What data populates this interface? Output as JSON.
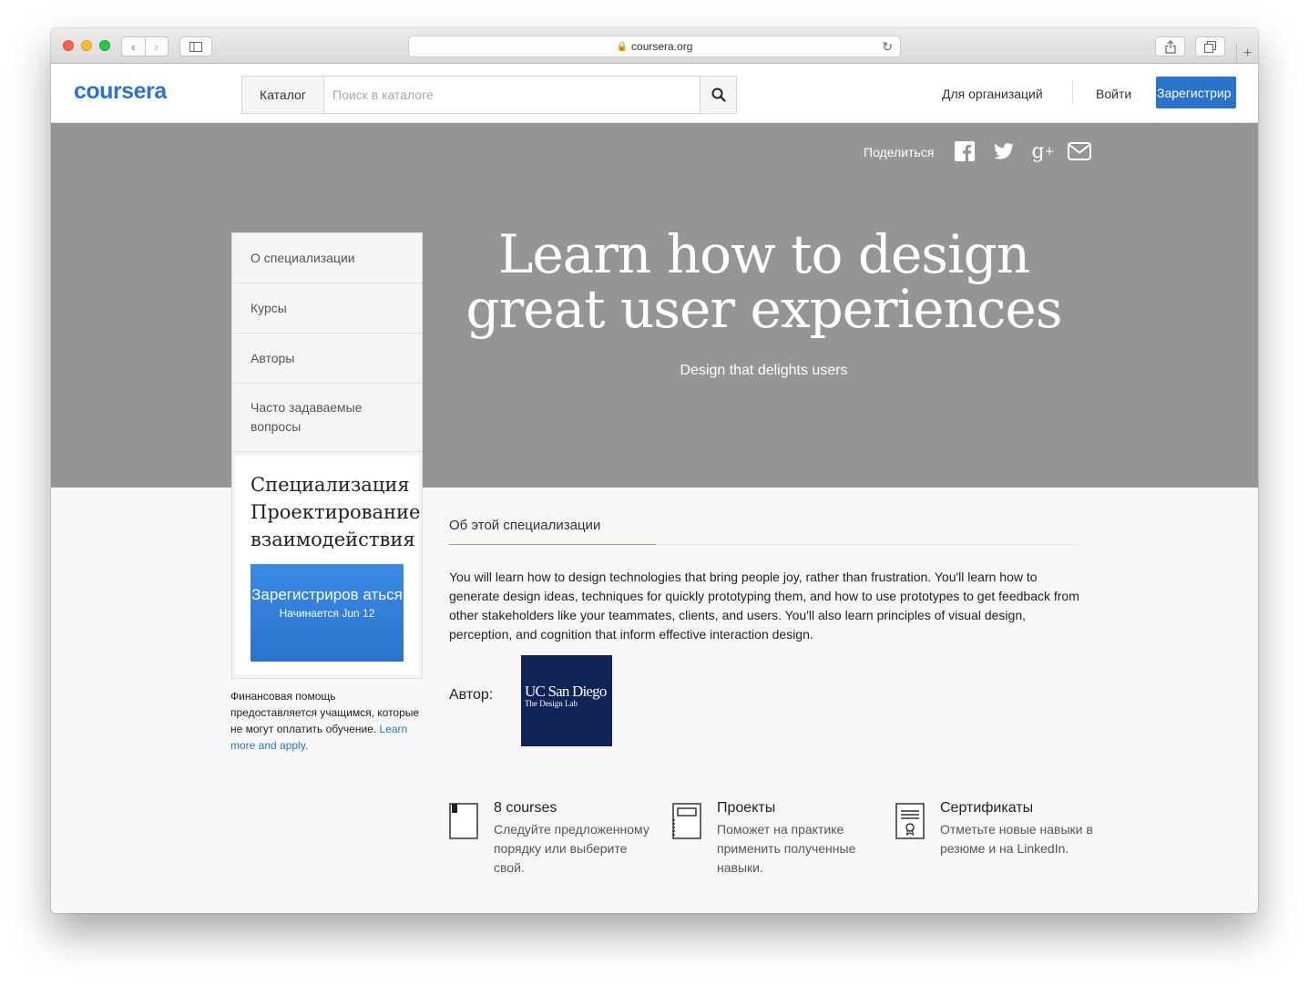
{
  "browser": {
    "url": "coursera.org"
  },
  "header": {
    "logo": "coursera",
    "catalog_label": "Каталог",
    "search_placeholder": "Поиск в каталоге",
    "orgs_label": "Для организаций",
    "login_label": "Войти",
    "signup_label": "Зарегистрир"
  },
  "hero": {
    "share_label": "Поделиться",
    "title": "Learn how to design great user experiences",
    "subtitle": "Design that delights users"
  },
  "sidebar": {
    "items": [
      {
        "label": "О специализации"
      },
      {
        "label": "Курсы"
      },
      {
        "label": "Авторы"
      },
      {
        "label": "Часто задаваемые вопросы"
      }
    ],
    "spec_title_lines": [
      "Специализация",
      "Проектирование",
      "взаимодействия"
    ],
    "enroll_label": "Зарегистриров аться",
    "enroll_start": "Начинается Jun 12",
    "finance_text": "Финансовая помощь предоставляется учащимся, которые не могут оплатить обучение.",
    "finance_link": "Learn more and apply."
  },
  "main": {
    "about_tab": "Об этой специализации",
    "about_text": "You will learn how to design technologies that bring people joy, rather than frustration. You'll learn how to generate design ideas, techniques for quickly prototyping them, and how to use prototypes to get feedback from other stakeholders like your teammates, clients, and users. You'll also learn principles of visual design, perception, and cognition that inform effective interaction design.",
    "author_label": "Автор:",
    "author_logo_name": "UC San Diego",
    "author_logo_sub": "The Design Lab",
    "features": [
      {
        "icon": "book-icon",
        "title": "8 courses",
        "desc": "Следуйте предложенному порядку или выберите свой."
      },
      {
        "icon": "notebook-icon",
        "title": "Проекты",
        "desc": "Поможет на практике применить полученные навыки."
      },
      {
        "icon": "certificate-icon",
        "title": "Сертификаты",
        "desc": "Отметьте новые навыки в резюме и на LinkedIn."
      }
    ]
  },
  "colors": {
    "brand": "#2a73cc",
    "hero_bg": "#959595",
    "ucsd_navy": "#0f2357"
  }
}
